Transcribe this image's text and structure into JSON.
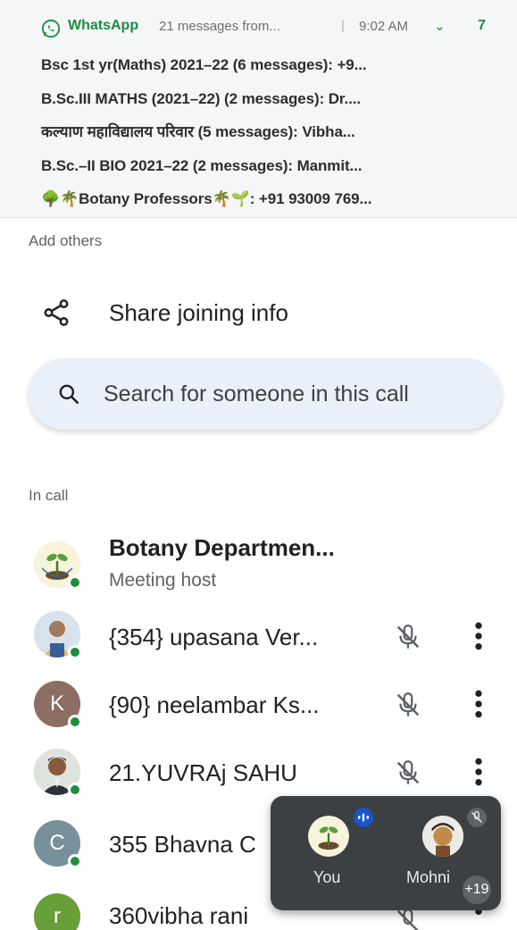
{
  "notification": {
    "app_name": "WhatsApp",
    "summary": "21 messages from...",
    "separator": "|",
    "time": "9:02 AM",
    "expand_glyph": "⌄",
    "count": "7",
    "lines": [
      "Bsc 1st yr(Maths) 2021–22 (6 messages): +9...",
      "B.Sc.III MATHS (2021–22) (2 messages): Dr....",
      "कल्याण महाविद्यालय परिवार (5 messages): Vibha...",
      "B.Sc.–II BIO 2021–22 (2 messages): Manmit...",
      "🌳🌴Botany Professors🌴🌱: +91 93009 769..."
    ],
    "accent_color": "#1b8d42"
  },
  "add_others": {
    "heading": "Add others",
    "share_label": "Share joining info",
    "search_placeholder": "Search for someone in this call"
  },
  "in_call": {
    "heading": "In call",
    "participants": [
      {
        "name": "Botany Departmen...",
        "subtitle": "Meeting host",
        "avatar": "logo",
        "muted": false
      },
      {
        "name": "{354} upasana Ver...",
        "avatar": "photo",
        "muted": true
      },
      {
        "name": "{90} neelambar Ks...",
        "avatar": "letter",
        "letter": "K",
        "color": "#8d6e63",
        "muted": true
      },
      {
        "name": "21.YUVRAj SAHU",
        "avatar": "photo",
        "muted": true
      },
      {
        "name": "355 Bhavna C",
        "avatar": "letter",
        "letter": "C",
        "color": "#78909c",
        "muted": true
      },
      {
        "name": "360vibha rani",
        "avatar": "letter",
        "letter": "r",
        "color": "#689f38",
        "muted": true
      }
    ]
  },
  "self_view": {
    "you_label": "You",
    "other_label": "Mohni",
    "more_count": "+19"
  }
}
